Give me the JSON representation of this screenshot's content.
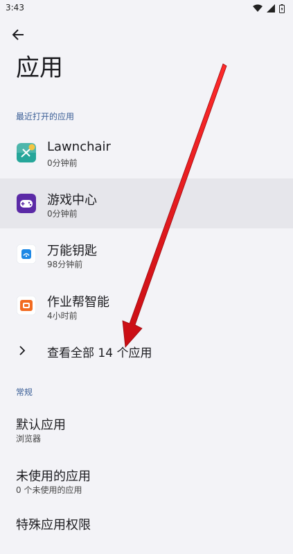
{
  "status": {
    "time": "3:43"
  },
  "page": {
    "title": "应用"
  },
  "recent": {
    "header": "最近打开的应用",
    "apps": [
      {
        "name": "Lawnchair",
        "time": "0分钟前",
        "icon": "lawnchair-icon"
      },
      {
        "name": "游戏中心",
        "time": "0分钟前",
        "icon": "game-center-icon"
      },
      {
        "name": "万能钥匙",
        "time": "98分钟前",
        "icon": "wifi-key-icon"
      },
      {
        "name": "作业帮智能",
        "time": "4小时前",
        "icon": "zuoyebang-icon"
      }
    ],
    "see_all": "查看全部 14 个应用"
  },
  "general": {
    "header": "常规",
    "items": [
      {
        "title": "默认应用",
        "subtitle": "浏览器"
      },
      {
        "title": "未使用的应用",
        "subtitle": "0 个未使用的应用"
      },
      {
        "title": "特殊应用权限",
        "subtitle": ""
      }
    ]
  },
  "colors": {
    "accent": "#3a5e96",
    "annotation_arrow": "#e8101a",
    "highlight_row": "#e6e6eb"
  }
}
